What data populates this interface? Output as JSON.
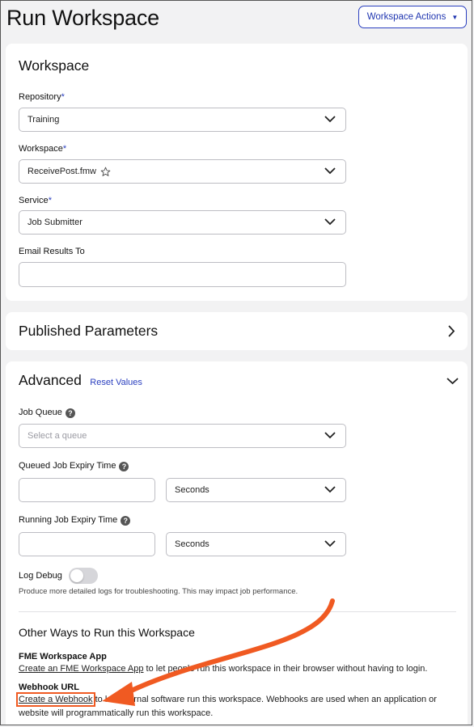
{
  "page": {
    "title": "Run Workspace",
    "actions_label": "Workspace Actions"
  },
  "workspace_section": {
    "heading": "Workspace",
    "repository": {
      "label": "Repository",
      "required_mark": "*",
      "value": "Training"
    },
    "workspace": {
      "label": "Workspace",
      "required_mark": "*",
      "value": "ReceivePost.fmw"
    },
    "service": {
      "label": "Service",
      "required_mark": "*",
      "value": "Job Submitter"
    },
    "email": {
      "label": "Email Results To",
      "value": ""
    }
  },
  "published_parameters": {
    "heading": "Published Parameters"
  },
  "advanced": {
    "heading": "Advanced",
    "reset_label": "Reset Values",
    "job_queue": {
      "label": "Job Queue",
      "placeholder": "Select a queue"
    },
    "queued_expiry": {
      "label": "Queued Job Expiry Time",
      "value": "",
      "unit": "Seconds"
    },
    "running_expiry": {
      "label": "Running Job Expiry Time",
      "value": "",
      "unit": "Seconds"
    },
    "log_debug": {
      "label": "Log Debug",
      "on": false,
      "hint": "Produce more detailed logs for troubleshooting. This may impact job performance."
    }
  },
  "other_ways": {
    "heading": "Other Ways to Run this Workspace",
    "app": {
      "title": "FME Workspace App",
      "link": "Create an FME Workspace App",
      "text": " to let people run this workspace in their browser without having to login."
    },
    "webhook": {
      "title": "Webhook URL",
      "link": "Create a Webhook",
      "text": " to let external software run this workspace. Webhooks are used when an application or website will programmatically run this workspace."
    }
  },
  "colors": {
    "accent": "#2a3fbf",
    "annotation": "#f05a22"
  }
}
